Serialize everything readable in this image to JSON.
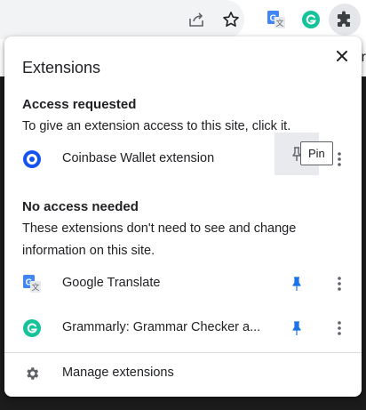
{
  "popup": {
    "title": "Extensions",
    "close_icon": "close-icon"
  },
  "access_requested": {
    "title": "Access requested",
    "description": "To give an extension access to this site, click it.",
    "items": [
      {
        "name": "Coinbase Wallet extension",
        "icon": "coinbase-wallet-icon",
        "pinned": false
      }
    ]
  },
  "tooltip": "Pin",
  "no_access": {
    "title": "No access needed",
    "description": "These extensions don't need to see and change information on this site.",
    "items": [
      {
        "name": "Google Translate",
        "icon": "google-translate-icon",
        "pinned": true
      },
      {
        "name": "Grammarly: Grammar Checker a...",
        "icon": "grammarly-icon",
        "pinned": true
      }
    ]
  },
  "manage": {
    "label": "Manage extensions",
    "icon": "gear-icon"
  },
  "toolbar": {
    "icons": [
      "share-icon",
      "bookmark-star-icon",
      "google-translate-icon",
      "grammarly-icon",
      "extensions-puzzle-icon"
    ]
  },
  "page": {
    "edge_text": "r"
  },
  "colors": {
    "accent": "#1a73e8",
    "coinbase": "#1652f0",
    "grammarly": "#15c39a",
    "icon_gray": "#5f6368"
  }
}
